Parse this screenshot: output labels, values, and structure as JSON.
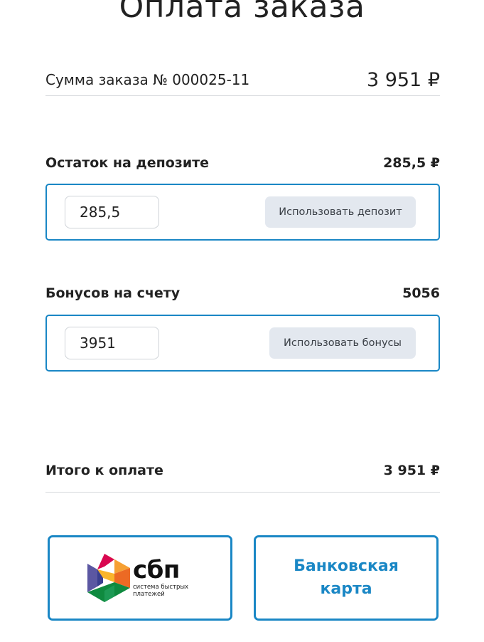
{
  "page": {
    "title": "Оплата заказа"
  },
  "order": {
    "label": "Сумма заказа № 000025-11",
    "amount": "3 951 ₽"
  },
  "deposit": {
    "label": "Остаток на депозите",
    "balance": "285,5 ₽",
    "input_value": "285,5",
    "button_label": "Использовать депозит"
  },
  "bonus": {
    "label": "Бонусов на счету",
    "balance": "5056",
    "input_value": "3951",
    "button_label": "Использовать бонусы"
  },
  "total": {
    "label": "Итого к оплате",
    "amount": "3 951 ₽"
  },
  "payment": {
    "sbp_logo_text": "сбп",
    "sbp_subtitle": "система быстрых платежей",
    "card_label": "Банковская карта"
  },
  "colors": {
    "accent": "#1a87c5",
    "button_bg": "#e3e8ef",
    "divider": "#d5d8dc"
  }
}
